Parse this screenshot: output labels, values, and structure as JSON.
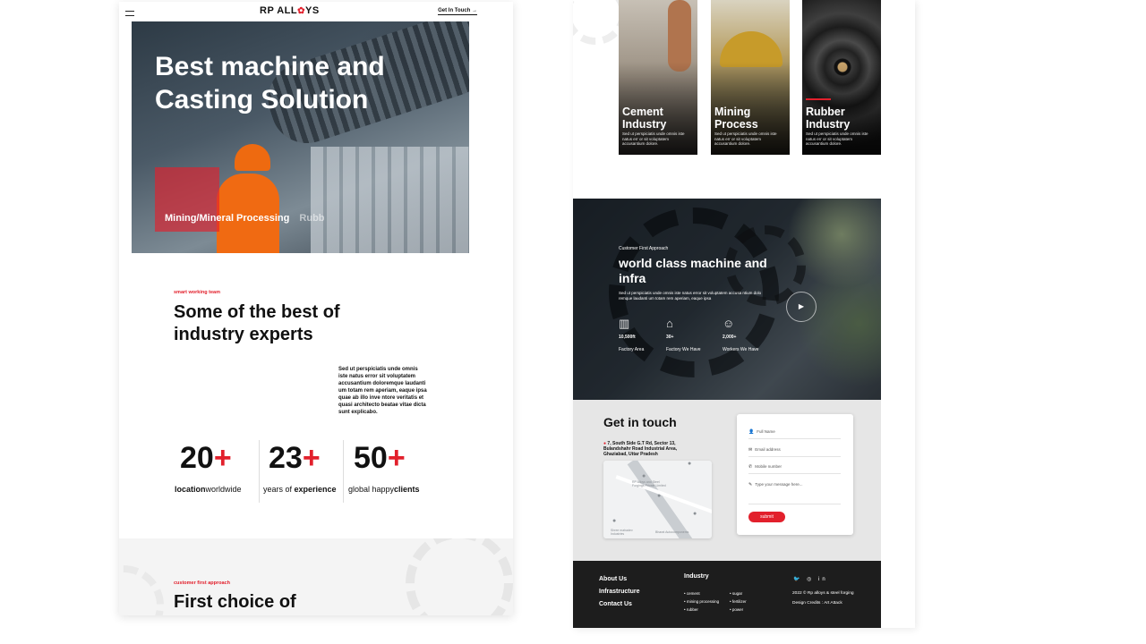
{
  "left_page": {
    "nav": {
      "logo": "RP ALL",
      "logo_gear": "✿",
      "logo_tail": "YS",
      "cta": "Get In Touch →"
    },
    "hero": {
      "title": "Best machine and Casting Solution",
      "tabs": [
        "Mining/Mineral Processing",
        "Rubb"
      ]
    },
    "experts": {
      "eyebrow": "smart working team",
      "title": "Some of the best of industry experts",
      "body": "Sed ut perspiciatis unde omnis iste natus error sit voluptatem accusantium doloremque laudanti um totam rem aperiam, eaque ipsa quae ab illo inve ntore veritatis et quasi architecto beatae vitae dicta sunt explicabo."
    },
    "stats": [
      {
        "num": "20",
        "plus": "+",
        "label_bold": "location",
        "label_rest": "worldwide"
      },
      {
        "num": "23",
        "plus": "+",
        "label_pre": "years of ",
        "label_bold": "experience"
      },
      {
        "num": "50",
        "plus": "+",
        "label_pre": "global happy",
        "label_bold": "clients"
      }
    ],
    "choice": {
      "eyebrow": "customer first approach",
      "title": "First choice of"
    }
  },
  "right_page": {
    "industries": [
      {
        "title": "Cement Industry",
        "body": "Sed ut perspiciatis unde omnis iste natus err or sit voluptatem accusantium dolore."
      },
      {
        "title": "Mining Process",
        "body": "Sed ut perspiciatis unde omnis iste natus err or sit voluptatem accusantium dolore."
      },
      {
        "title": "Rubber Industry",
        "body": "Sed ut perspiciatis unde omnis iste natus err or sit voluptatem accusantium dolore."
      }
    ],
    "world": {
      "eyebrow": "Customer First Approach",
      "title": "world class machine and infra",
      "body": "Sed ut perspiciatis unde omnis iste natus error sit voluptatem accusa ntium dolo remque laudanti um totam rem aperiam, eaque ipsa",
      "play_icon": "▶",
      "stats": [
        {
          "icon": "▥",
          "value": "10,500ft",
          "label": "Factory Area"
        },
        {
          "icon": "⌂",
          "value": "30+",
          "label": "Factory We Have"
        },
        {
          "icon": "☺",
          "value": "2,000+",
          "label": "Workers We Have"
        }
      ]
    },
    "contact": {
      "title": "Get in touch",
      "address": "7, South Side G.T Rd, Sector 13, Bulandshahr Road Industrial Area, Ghaziabad, Uttar Pradesh",
      "map_label_1": "RP Alloys and Steel Forgings Private Limited",
      "map_label_2": "Shree mahadev Industries",
      "map_label_3": "Bharat Autocomponents",
      "fields": [
        {
          "icon": "👤",
          "placeholder": "Full Name"
        },
        {
          "icon": "✉",
          "placeholder": "Email address"
        },
        {
          "icon": "✆",
          "placeholder": "Mobile number"
        },
        {
          "icon": "✎",
          "placeholder": "Type your message here..."
        }
      ],
      "submit": "submit"
    },
    "footer": {
      "links": [
        "About Us",
        "Infrastructure",
        "Contact Us"
      ],
      "industry_title": "Industry",
      "industry_col1": [
        "cement",
        "mining processing",
        "rubber"
      ],
      "industry_col2": [
        "sugar",
        "fertilizer",
        "power"
      ],
      "social": "🐦 ◎ in",
      "copyright": "2022 © Rp alloys & steel forging",
      "credits": "Design Credits : Art Attack"
    }
  },
  "colors": {
    "accent": "#e2202c",
    "footer_bg": "#1d1d1d",
    "contact_bg": "#e6e6e6"
  }
}
